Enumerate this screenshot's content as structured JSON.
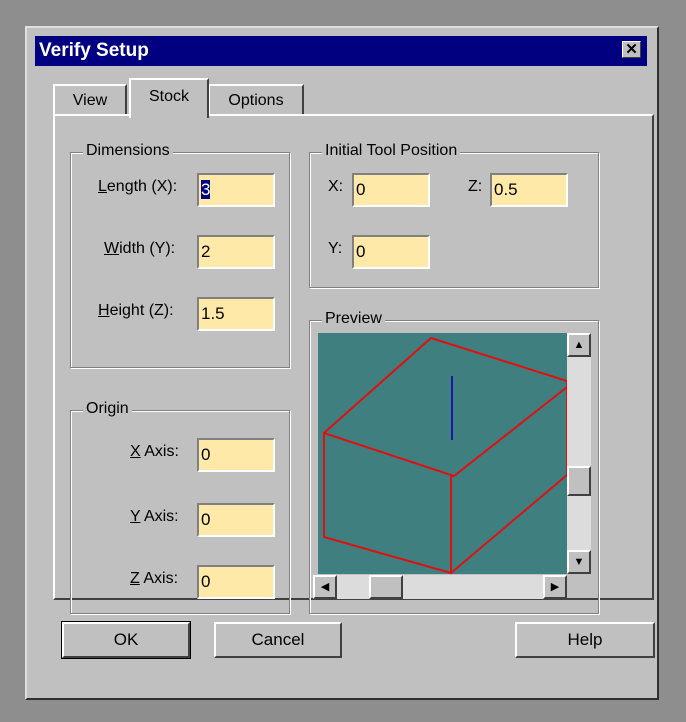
{
  "window": {
    "title": "Verify Setup",
    "close_label": "✕"
  },
  "tabs": {
    "view": "View",
    "stock": "Stock",
    "options": "Options"
  },
  "dimensions": {
    "legend": "Dimensions",
    "length": {
      "underline": "L",
      "rest": "ength (X):",
      "value": "3"
    },
    "width": {
      "underline": "W",
      "rest": "idth (Y):",
      "value": "2"
    },
    "height": {
      "underline": "H",
      "rest": "eight (Z):",
      "value": "1.5"
    }
  },
  "origin": {
    "legend": "Origin",
    "x": {
      "underline": "X",
      "rest": " Axis:",
      "value": "0"
    },
    "y": {
      "underline": "Y",
      "rest": " Axis:",
      "value": "0"
    },
    "z": {
      "underline": "Z",
      "rest": " Axis:",
      "value": "0"
    }
  },
  "initial_tool_position": {
    "legend": "Initial Tool Position",
    "x_label": "X:",
    "x_value": "0",
    "y_label": "Y:",
    "y_value": "0",
    "z_label": "Z:",
    "z_value": "0.5"
  },
  "preview": {
    "legend": "Preview",
    "background_color": "#3f7f7f",
    "box_color": "#e01010",
    "tool_color": "#1a1ab0"
  },
  "buttons": {
    "ok": "OK",
    "cancel": "Cancel",
    "help": "Help"
  }
}
